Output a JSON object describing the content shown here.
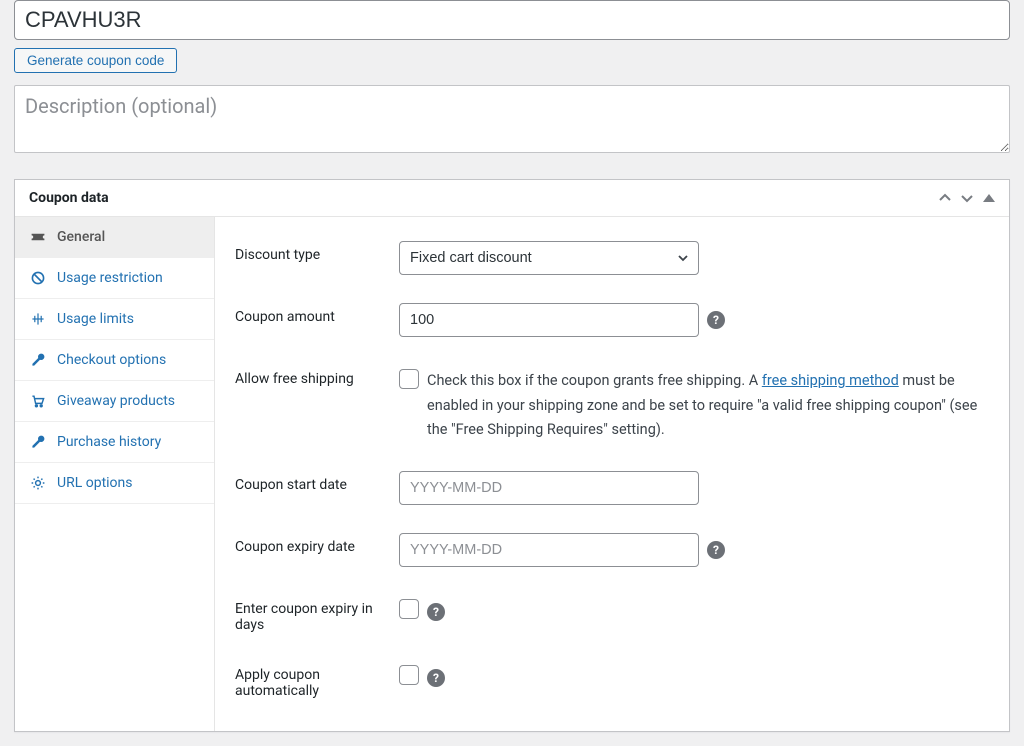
{
  "coupon_code": "CPAVHU3R",
  "generate_button_label": "Generate coupon code",
  "description_placeholder": "Description (optional)",
  "panel_title": "Coupon data",
  "sidebar": {
    "items": [
      {
        "label": "General"
      },
      {
        "label": "Usage restriction"
      },
      {
        "label": "Usage limits"
      },
      {
        "label": "Checkout options"
      },
      {
        "label": "Giveaway products"
      },
      {
        "label": "Purchase history"
      },
      {
        "label": "URL options"
      }
    ]
  },
  "fields": {
    "discount_type_label": "Discount type",
    "discount_type_value": "Fixed cart discount",
    "coupon_amount_label": "Coupon amount",
    "coupon_amount_value": "100",
    "free_shipping_label": "Allow free shipping",
    "free_shipping_text_1": "Check this box if the coupon grants free shipping. A ",
    "free_shipping_link": "free shipping method",
    "free_shipping_text_2": " must be enabled in your shipping zone and be set to require \"a valid free shipping coupon\" (see the \"Free Shipping Requires\" setting).",
    "start_date_label": "Coupon start date",
    "start_date_placeholder": "YYYY-MM-DD",
    "expiry_date_label": "Coupon expiry date",
    "expiry_date_placeholder": "YYYY-MM-DD",
    "expiry_days_label": "Enter coupon expiry in days",
    "apply_auto_label": "Apply coupon automatically"
  }
}
